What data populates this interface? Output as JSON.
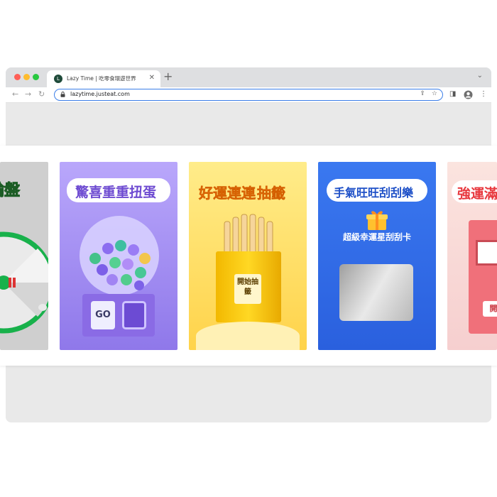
{
  "browser": {
    "tab_title": "Lazy Time | 吃零食環遊世界",
    "favicon_letter": "L",
    "url": "lazytime.justeat.com",
    "icons": [
      "back-icon",
      "forward-icon",
      "reload-icon",
      "lock-icon",
      "share-icon",
      "bookmark-star-icon",
      "sidebar-icon",
      "profile-icon",
      "menu-kebab-icon"
    ]
  },
  "cards": {
    "wheel": {
      "title": "轉輪盤",
      "color": "#bfbfbf"
    },
    "gacha": {
      "title": "驚喜重重扭蛋",
      "button": "GO",
      "color": "#9a84f0"
    },
    "lottery": {
      "title_a": "好運連連",
      "title_b": "抽籤",
      "box_label": "開始抽籤",
      "color": "#ffe04f"
    },
    "scratch": {
      "title": "手氣旺旺刮刮樂",
      "subtitle": "超級幸運星刮刮卡",
      "color": "#2c69e8"
    },
    "slot": {
      "title": "強運滿",
      "button": "開",
      "color": "#f7d6d0"
    }
  }
}
